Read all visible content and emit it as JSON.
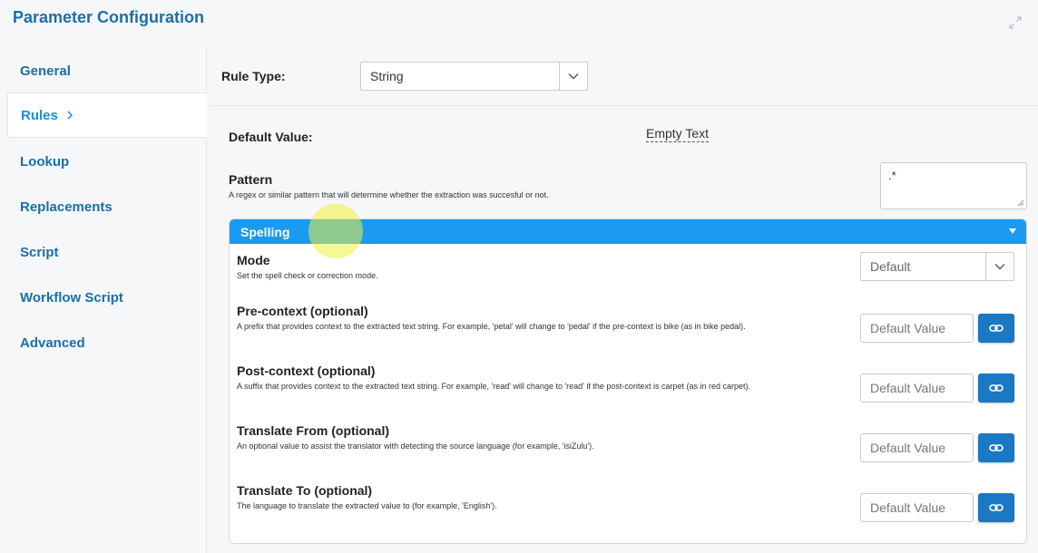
{
  "header": {
    "title": "Parameter Configuration",
    "expand_icon": "expand-icon"
  },
  "sidebar": {
    "items": [
      {
        "label": "General"
      },
      {
        "label": "Rules",
        "active": true
      },
      {
        "label": "Lookup"
      },
      {
        "label": "Replacements"
      },
      {
        "label": "Script"
      },
      {
        "label": "Workflow Script"
      },
      {
        "label": "Advanced"
      }
    ]
  },
  "rule_type": {
    "label": "Rule Type:",
    "value": "String"
  },
  "default_value": {
    "label": "Default Value:",
    "value": "Empty Text"
  },
  "pattern": {
    "label": "Pattern",
    "description": "A regex or similar pattern that will determine whether the extraction was succesful or not.",
    "value": ".*"
  },
  "spelling": {
    "header": "Spelling",
    "mode": {
      "label": "Mode",
      "description": "Set the spell check or correction mode.",
      "value": "Default"
    },
    "fields": [
      {
        "label": "Pre-context (optional)",
        "description": "A prefix that provides context to the extracted text string. For example, 'petal' will change to 'pedal' if the pre-context is bike (as in bike pedal).",
        "placeholder": "Default Value"
      },
      {
        "label": "Post-context (optional)",
        "description": "A suffix that provides context to the extracted text string. For example, 'read' will change to 'read' if the post-context is carpet (as in red carpet).",
        "placeholder": "Default Value"
      },
      {
        "label": "Translate From (optional)",
        "description": "An optional value to assist the translator with detecting the source language (for example, 'isiZulu').",
        "placeholder": "Default Value"
      },
      {
        "label": "Translate To (optional)",
        "description": "The language to translate the extracted value to (for example, 'English').",
        "placeholder": "Default Value"
      }
    ]
  },
  "colors": {
    "accent": "#1a9af0",
    "title": "#1a6fa8",
    "button": "#1b78c4"
  }
}
